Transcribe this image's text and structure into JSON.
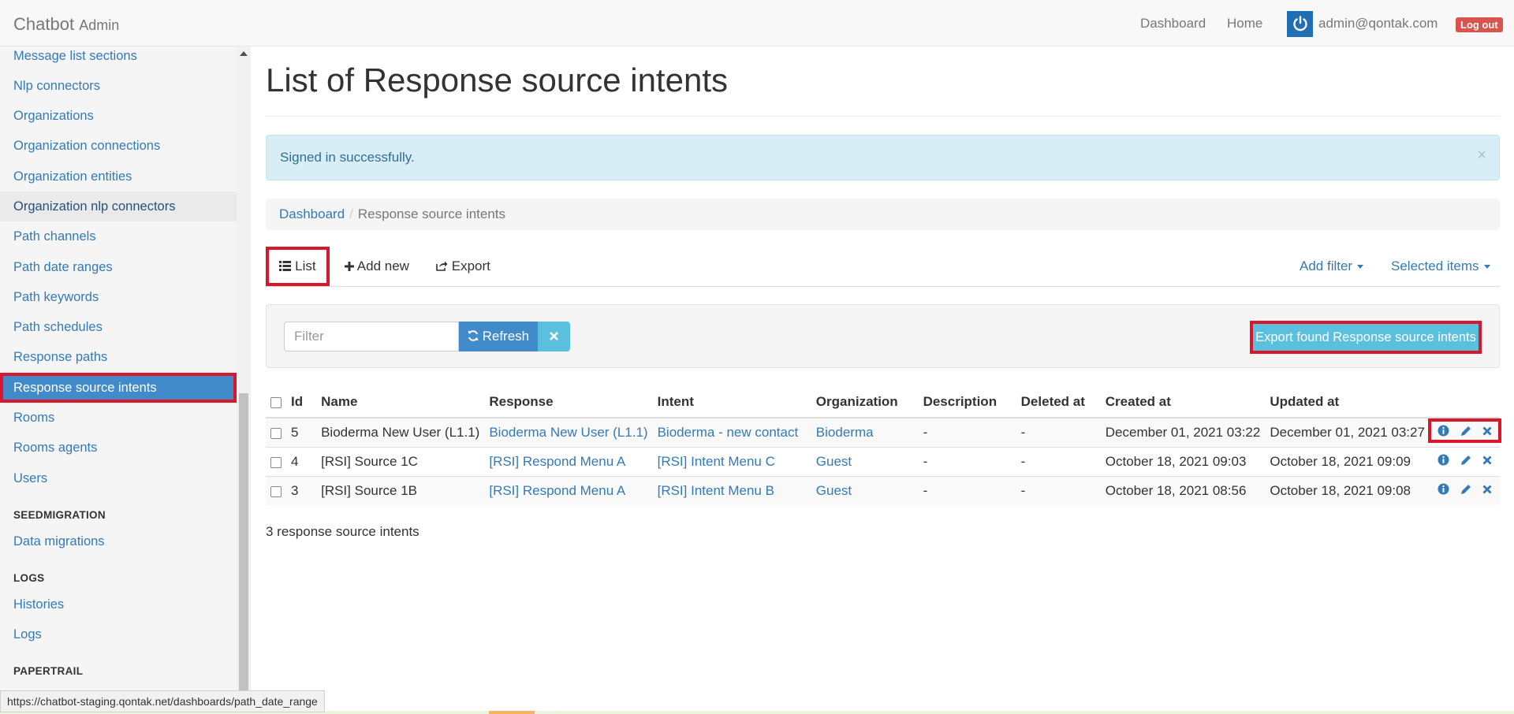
{
  "navbar": {
    "brand": "Chatbot",
    "brand_sub": "Admin",
    "links": [
      "Dashboard",
      "Home"
    ],
    "user_email": "admin@qontak.com",
    "logout_label": "Log out"
  },
  "sidebar": {
    "items_top": [
      "Message list sections",
      "Nlp connectors",
      "Organizations",
      "Organization connections",
      "Organization entities",
      "Organization nlp connectors",
      "Path channels",
      "Path date ranges",
      "Path keywords",
      "Path schedules",
      "Response paths",
      "Response source intents",
      "Rooms",
      "Rooms agents",
      "Users"
    ],
    "section_seed": "SEEDMIGRATION",
    "item_seed": "Data migrations",
    "section_logs": "LOGS",
    "items_logs": [
      "Histories",
      "Logs"
    ],
    "section_papertrail": "PAPERTRAIL"
  },
  "status_url": "https://chatbot-staging.qontak.net/dashboards/path_date_range",
  "main": {
    "title": "List of Response source intents",
    "alert": "Signed in successfully.",
    "alert_close": "×",
    "breadcrumb": {
      "home": "Dashboard",
      "separator": "/",
      "current": "Response source intents"
    },
    "tabs": {
      "list": "List",
      "add_new": "Add new",
      "export": "Export",
      "add_filter": "Add filter",
      "selected_items": "Selected items"
    },
    "filter": {
      "placeholder": "Filter",
      "refresh": "Refresh",
      "export_found": "Export found Response source intents"
    },
    "table": {
      "headers": [
        "Id",
        "Name",
        "Response",
        "Intent",
        "Organization",
        "Description",
        "Deleted at",
        "Created at",
        "Updated at"
      ],
      "rows": [
        {
          "id": "5",
          "name": "Bioderma New User (L1.1)",
          "response": "Bioderma New User (L1.1)",
          "intent": "Bioderma - new contact",
          "organization": "Bioderma",
          "description": "-",
          "deleted_at": "-",
          "created_at": "December 01, 2021 03:22",
          "updated_at": "December 01, 2021 03:27"
        },
        {
          "id": "4",
          "name": "[RSI] Source 1C",
          "response": "[RSI] Respond Menu A",
          "intent": "[RSI] Intent Menu C",
          "organization": "Guest",
          "description": "-",
          "deleted_at": "-",
          "created_at": "October 18, 2021 09:03",
          "updated_at": "October 18, 2021 09:09"
        },
        {
          "id": "3",
          "name": "[RSI] Source 1B",
          "response": "[RSI] Respond Menu A",
          "intent": "[RSI] Intent Menu B",
          "organization": "Guest",
          "description": "-",
          "deleted_at": "-",
          "created_at": "October 18, 2021 08:56",
          "updated_at": "October 18, 2021 09:08"
        }
      ],
      "count_text": "3 response source intents"
    }
  },
  "colors": {
    "primary": "#428bca",
    "info": "#5bc0de",
    "danger": "#d9534f",
    "highlight": "#d9172b",
    "link": "#337ab7"
  }
}
